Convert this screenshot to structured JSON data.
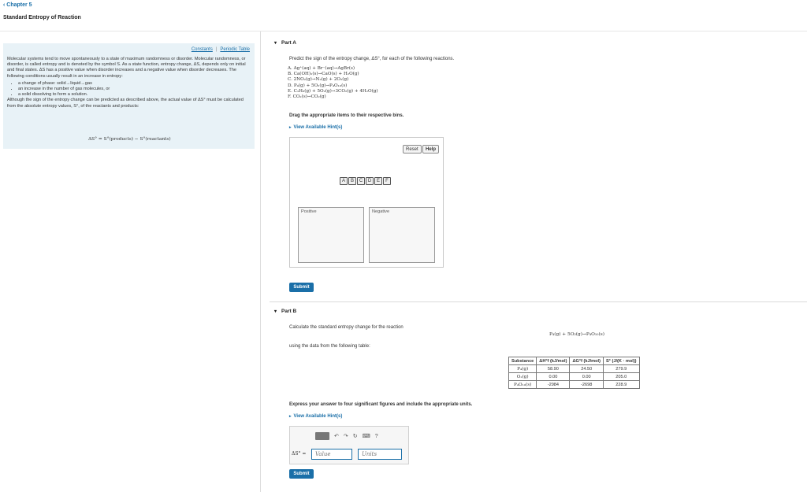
{
  "header": {
    "back_label": "Chapter 5",
    "page_title": "Standard Entropy of Reaction"
  },
  "sidebar": {
    "links": {
      "constants": "Constants",
      "separator": "|",
      "periodic_table": "Periodic Table"
    },
    "paragraph1": "Molecular systems tend to move spontaneously to a state of maximum randomness or disorder. Molecular randomness, or disorder, is called entropy and is denoted by the symbol S. As a state function, entropy change, ΔS, depends only on initial and final states. ΔS has a positive value when disorder increases and a negative value when disorder decreases. The following conditions usually result in an increase in entropy:",
    "bullets": [
      "a change of phase: solid→liquid→gas",
      "an increase in the number of gas molecules, or",
      "a solid dissolving to form a solution."
    ],
    "paragraph2": "Although the sign of the entropy change can be predicted as described above, the actual value of ΔS° must be calculated from the absolute entropy values, S°, of the reactants and products:",
    "formula": "ΔS° = S°(products) − S°(reactants)"
  },
  "part_a": {
    "heading": "Part A",
    "prompt": "Predict the sign of the entropy change, ΔS°, for each of the following reactions.",
    "reactions": [
      "A. Ag⁺(aq) + Br⁻(aq)→AgBr(s)",
      "B. Ca(OH)₂(s)→CaO(s) + H₂O(g)",
      "C. 2NO₂(g)→N₂(g) + 2O₂(g)",
      "D. P₄(g) + 5O₂(g)→P₄O₁₀(s)",
      "E. C₃H₈(g) + 5O₂(g)→3CO₂(g) + 4H₂O(g)",
      "F. CO₂(s)→CO₂(g)"
    ],
    "instruction": "Drag the appropriate items to their respective bins.",
    "hint_label": "View Available Hint(s)",
    "reset_label": "Reset",
    "help_label": "Help",
    "tiles": [
      "A",
      "B",
      "C",
      "D",
      "E",
      "F"
    ],
    "bins": {
      "positive": "Positive",
      "negative": "Negative"
    },
    "submit_label": "Submit"
  },
  "part_b": {
    "heading": "Part B",
    "prompt": "Calculate the standard entropy change for the reaction",
    "reaction": "P₄(g) + 5O₂(g)→P₄O₁₀(s)",
    "table_intro": "using the data from the following table:",
    "table": {
      "headers": [
        "Substance",
        "ΔH°f (kJ/mol)",
        "ΔG°f (kJ/mol)",
        "S° (J/(K · mol))"
      ],
      "rows": [
        [
          "P₄(g)",
          "58.90",
          "24.50",
          "279.9"
        ],
        [
          "O₂(g)",
          "0.00",
          "0.00",
          "205.0"
        ],
        [
          "P₄O₁₀(s)",
          "-2984",
          "-2698",
          "228.9"
        ]
      ]
    },
    "express_text": "Express your answer to four significant figures and include the appropriate units.",
    "hint_label": "View Available Hint(s)",
    "answer_label": "ΔS° =",
    "value_placeholder": "Value",
    "units_placeholder": "Units",
    "submit_label": "Submit"
  }
}
